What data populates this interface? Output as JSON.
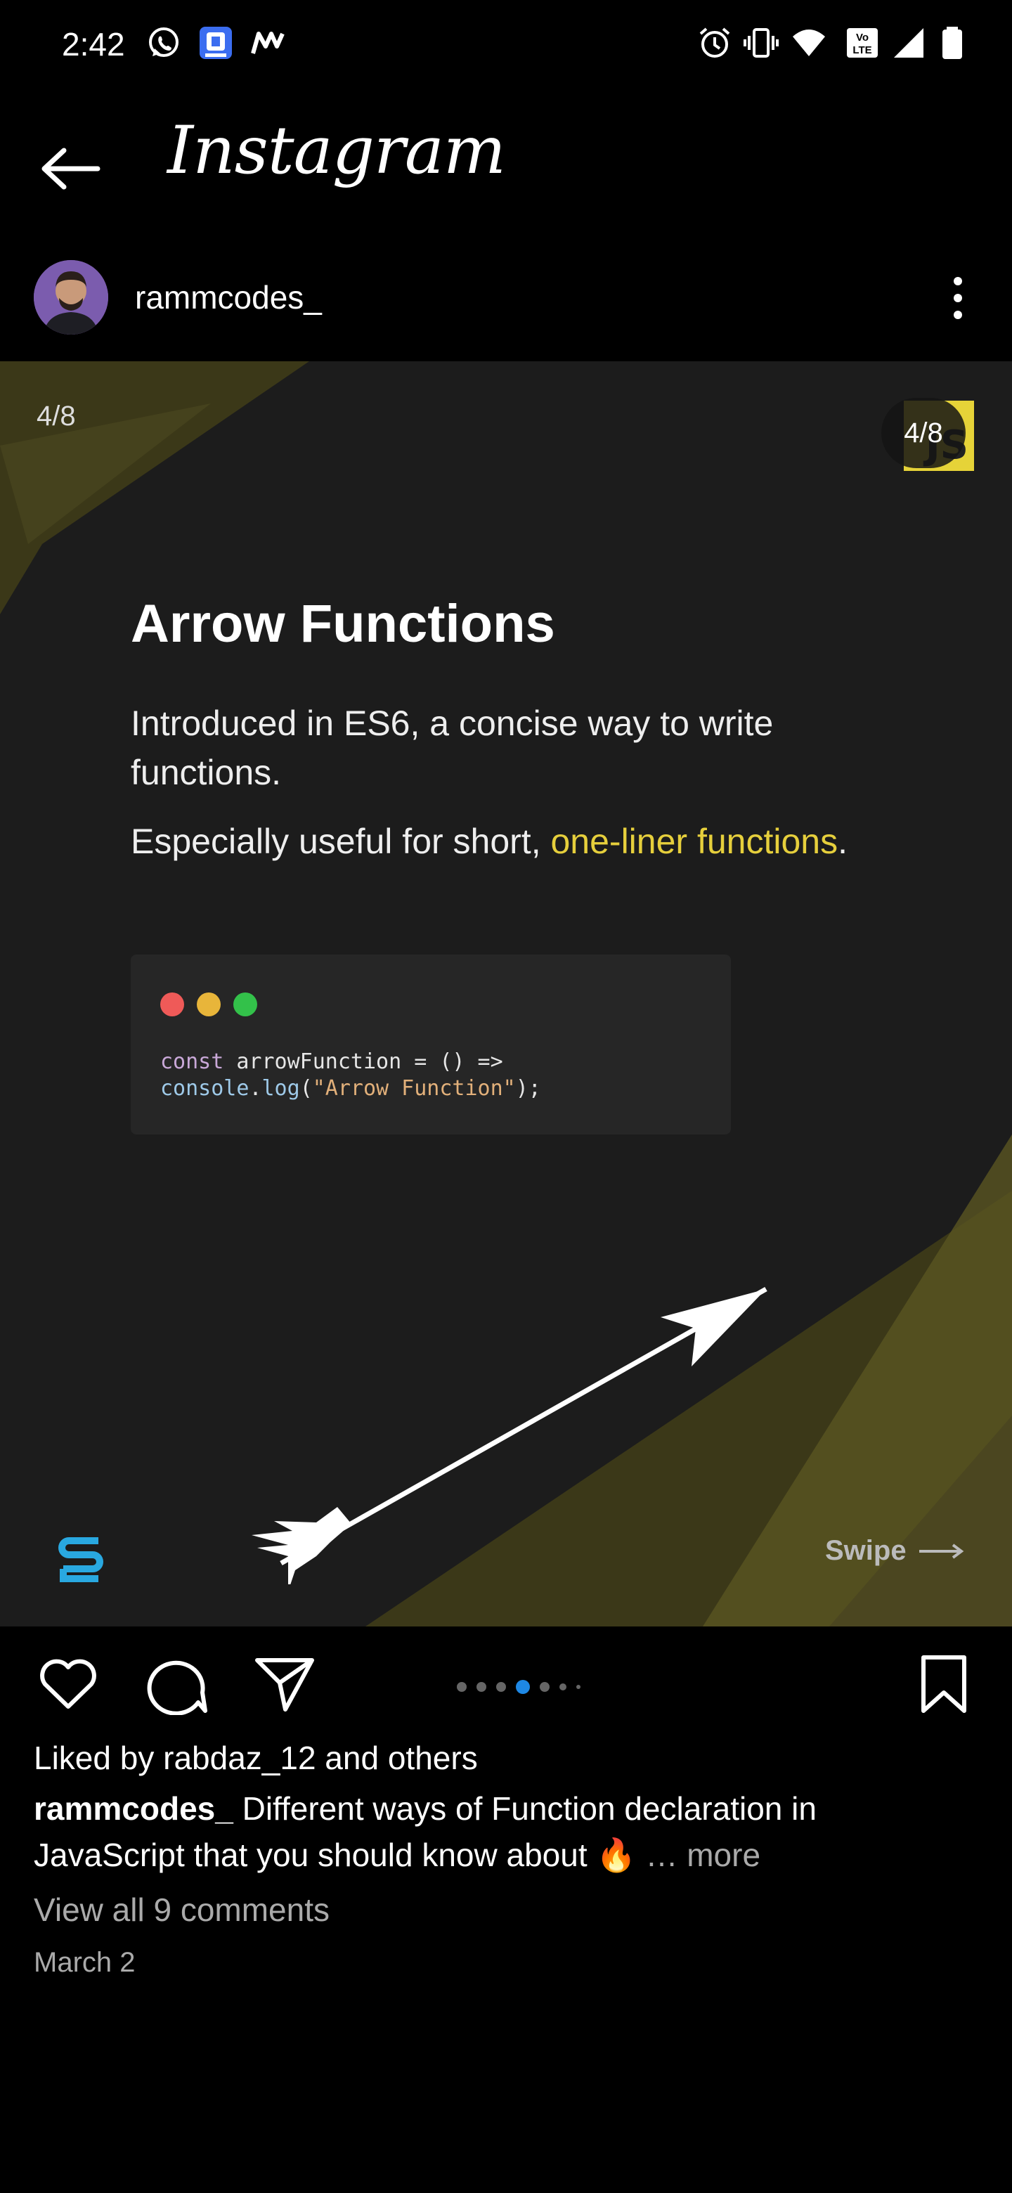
{
  "status_bar": {
    "time": "2:42",
    "left_icons": [
      "whatsapp-icon",
      "app-shield-icon",
      "m-app-icon"
    ],
    "right_icons": [
      "alarm-icon",
      "vibrate-icon",
      "wifi-icon",
      "volte-icon",
      "signal-icon",
      "battery-icon"
    ]
  },
  "header": {
    "title": "Instagram"
  },
  "profile": {
    "username": "rammcodes_"
  },
  "post": {
    "counter": "4/8",
    "badge_counter": "4/8",
    "badge_text": "JS",
    "title": "Arrow Functions",
    "paragraph1": "Introduced in ES6, a concise way to write functions.",
    "paragraph2_prefix": "Especially useful for short, ",
    "paragraph2_highlight": "one-liner functions",
    "paragraph2_suffix": ".",
    "code": {
      "line1_kw": "const",
      "line1_rest": " arrowFunction = () =>",
      "line2_obj": "console",
      "line2_dot": ".",
      "line2_fn": "log",
      "line2_open": "(",
      "line2_str": "\"Arrow Function\"",
      "line2_close": ");"
    },
    "swipe_label": "Swipe",
    "colors": {
      "highlight": "#e6cf3c",
      "js_badge": "#e6d338",
      "window_red": "#ef5a58",
      "window_yellow": "#e8b53a",
      "window_green": "#33c14a"
    }
  },
  "carousel": {
    "total": 8,
    "active_index": 3,
    "active_color": "#1e88e5"
  },
  "engagement": {
    "liked_prefix": "Liked by ",
    "liked_user": "rabdaz_12",
    "liked_suffix": " and others",
    "caption_user": "rammcodes_",
    "caption_text": " Different ways of Function declaration in JavaScript that you should know about 🔥",
    "more_label": "… more",
    "comments_link": "View all 9 comments",
    "date": "March 2"
  }
}
